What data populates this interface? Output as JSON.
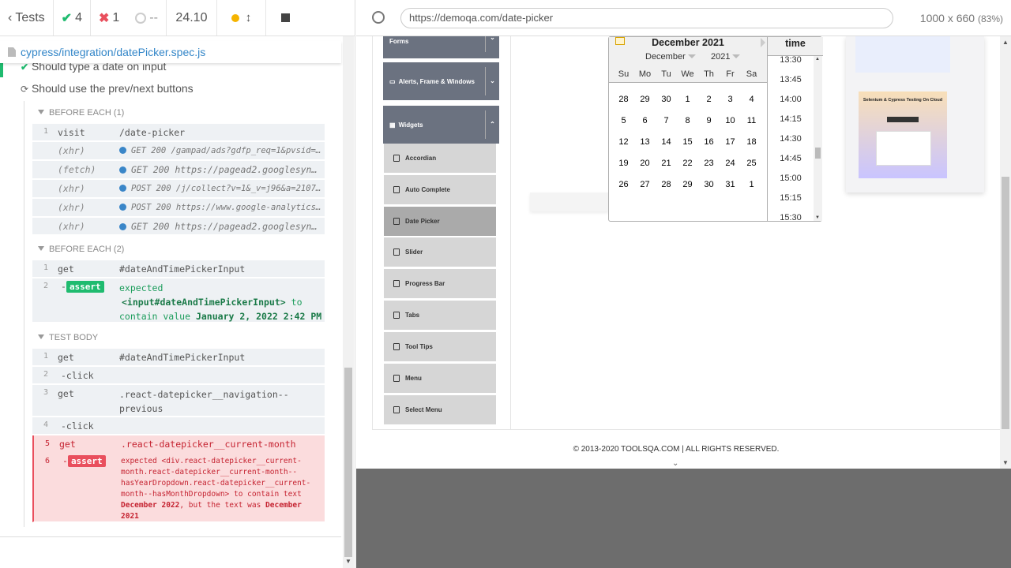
{
  "runner": {
    "back_label": "Tests",
    "passed": "4",
    "failed": "1",
    "pending": "--",
    "duration": "24.10",
    "spec_path": "cypress/integration/datePicker.spec.js"
  },
  "tests": {
    "t1": "Should type a date on input",
    "t2": "Should use the prev/next buttons"
  },
  "hooks": {
    "before1": "BEFORE EACH (1)",
    "before2": "BEFORE EACH (2)",
    "body": "TEST BODY"
  },
  "commands": {
    "c1": {
      "num": "1",
      "name": "visit",
      "msg": "/date-picker"
    },
    "x1": {
      "name": "(xhr)",
      "msg": "GET 200 /gampad/ads?gdfp_req=1&pvsid=1213…"
    },
    "x2": {
      "name": "(fetch)",
      "msg": "GET 200 https://pagead2.googlesynd…"
    },
    "x3": {
      "name": "(xhr)",
      "msg": "POST 200 /j/collect?v=1&_v=j96&a=21079067…"
    },
    "x4": {
      "name": "(xhr)",
      "msg": "POST 200 https://www.google-analytics.com…"
    },
    "x5": {
      "name": "(xhr)",
      "msg": "GET 200 https://pagead2.googlesynd…"
    },
    "b1": {
      "num": "1",
      "name": "get",
      "msg": "#dateAndTimePickerInput"
    },
    "b2": {
      "num": "2",
      "name": "-",
      "badge": "assert",
      "l1": "expected",
      "l2a": "<input#dateAndTimePickerInput>",
      "l2b": "to",
      "l3a": "contain value",
      "l3b": "January 2, 2022 2:42 PM"
    },
    "t1": {
      "num": "1",
      "name": "get",
      "msg": "#dateAndTimePickerInput"
    },
    "t2": {
      "num": "2",
      "name": "-click"
    },
    "t3": {
      "num": "3",
      "name": "get",
      "l1": ".react-datepicker__navigation--",
      "l2": "previous"
    },
    "t4": {
      "num": "4",
      "name": "-click"
    },
    "t5": {
      "num": "5",
      "name": "get",
      "msg": ".react-datepicker__current-month"
    },
    "t6": {
      "num": "6",
      "name": "-",
      "badge": "assert",
      "l1a": "expected",
      "l1b": "<div.react-datepicker__current-",
      "l2": "month.react-datepicker__current-month--",
      "l3": "hasYearDropdown.react-datepicker__current-",
      "l4a": "month--hasMonthDropdown>",
      "l4b": "to contain text",
      "l5a": "December 2022",
      "l5b": ", but the text was",
      "l5c": "December",
      "l6": "2021"
    }
  },
  "browser": {
    "url": "https://demoqa.com/date-picker",
    "viewport": "1000 x 660",
    "scale": "(83%)"
  },
  "site": {
    "groups": [
      "Forms",
      "Alerts, Frame & Windows",
      "Widgets"
    ],
    "items": [
      "Accordian",
      "Auto Complete",
      "Date Picker",
      "Slider",
      "Progress Bar",
      "Tabs",
      "Tool Tips",
      "Menu",
      "Select Menu"
    ],
    "footer": "© 2013-2020 TOOLSQA.COM | ALL RIGHTS RESERVED."
  },
  "datepicker": {
    "title": "December 2021",
    "month_select": "December",
    "year_select": "2021",
    "daynames": [
      "Su",
      "Mo",
      "Tu",
      "We",
      "Th",
      "Fr",
      "Sa"
    ],
    "weeks": [
      [
        "28",
        "29",
        "30",
        "1",
        "2",
        "3",
        "4"
      ],
      [
        "5",
        "6",
        "7",
        "8",
        "9",
        "10",
        "11"
      ],
      [
        "12",
        "13",
        "14",
        "15",
        "16",
        "17",
        "18"
      ],
      [
        "19",
        "20",
        "21",
        "22",
        "23",
        "24",
        "25"
      ],
      [
        "26",
        "27",
        "28",
        "29",
        "30",
        "31",
        "1"
      ]
    ],
    "time_header": "time",
    "times": [
      "13:30",
      "13:45",
      "14:00",
      "14:15",
      "14:30",
      "14:45",
      "15:00",
      "15:15",
      "15:30"
    ]
  },
  "ad": {
    "headline": "Selenium & Cypress Testing On Cloud"
  },
  "colors": {
    "pass": "#1fbb6f",
    "fail": "#e94f5d",
    "link": "#3386c8"
  }
}
